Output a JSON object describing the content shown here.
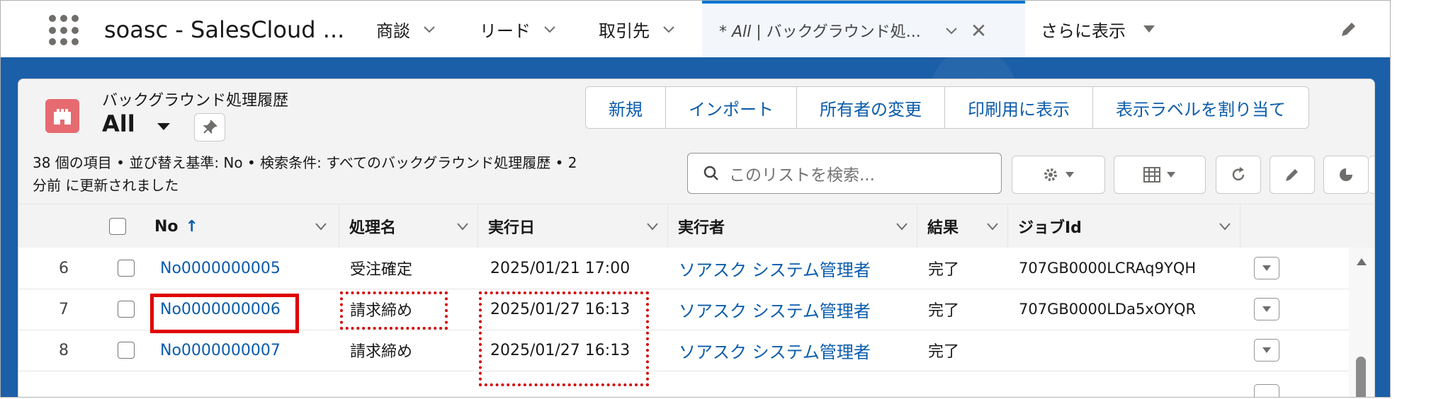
{
  "nav": {
    "app_name": "soasc - SalesCloud ...",
    "tabs": [
      {
        "label": "商談"
      },
      {
        "label": "リード"
      },
      {
        "label": "取引先"
      }
    ],
    "active_tab": {
      "prefix": "* ",
      "italic": "All",
      "rest": " | バックグラウンド処..."
    },
    "more_label": "さらに表示"
  },
  "header": {
    "object_label": "バックグラウンド処理履歴",
    "view_name": "All",
    "buttons": [
      "新規",
      "インポート",
      "所有者の変更",
      "印刷用に表示",
      "表示ラベルを割り当て"
    ],
    "meta_line1": "38 個の項目 • 並び替え基準: No • 検索条件: すべてのバックグラウンド処理履歴 • 2",
    "meta_line2": "分前 に更新されました",
    "search_placeholder": "このリストを検索..."
  },
  "table": {
    "columns": [
      "No",
      "処理名",
      "実行日",
      "実行者",
      "結果",
      "ジョブId"
    ],
    "sort_indicator": "↑",
    "rows": [
      {
        "num": "6",
        "no": "No0000000005",
        "name": "受注確定",
        "date": "2025/01/21 17:00",
        "user": "ソアスク システム管理者",
        "result": "完了",
        "job": "707GB0000LCRAq9YQH"
      },
      {
        "num": "7",
        "no": "No0000000006",
        "name": "請求締め",
        "date": "2025/01/27 16:13",
        "user": "ソアスク システム管理者",
        "result": "完了",
        "job": "707GB0000LDa5xOYQR"
      },
      {
        "num": "8",
        "no": "No0000000007",
        "name": "請求締め",
        "date": "2025/01/27 16:13",
        "user": "ソアスク システム管理者",
        "result": "完了",
        "job": ""
      }
    ]
  },
  "colors": {
    "brand_blue": "#0176d3",
    "link": "#0b5cab",
    "object_icon": "#e66b71",
    "highlight": "#e00000"
  }
}
